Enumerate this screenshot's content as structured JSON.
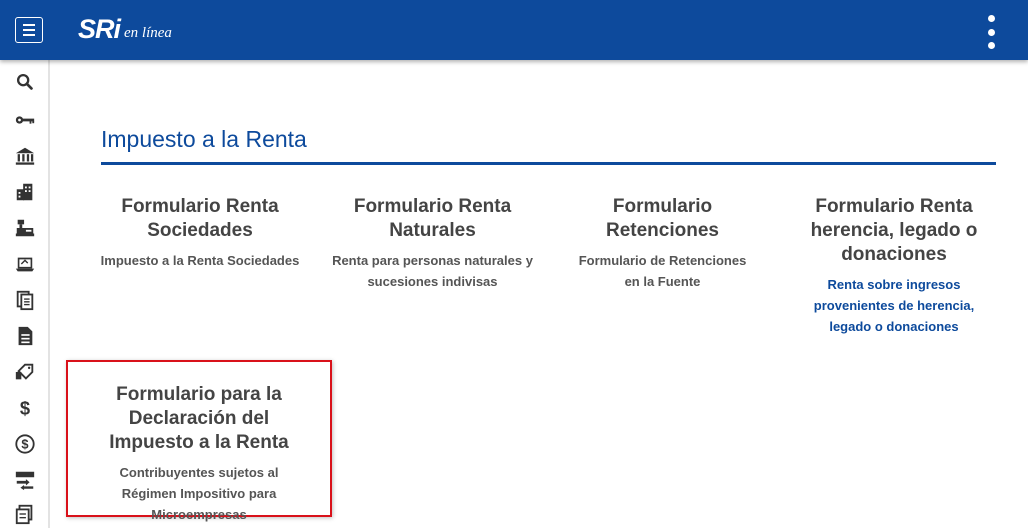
{
  "header": {
    "logo_main": "SRi",
    "logo_sub": "en línea"
  },
  "page": {
    "title": "Impuesto a la Renta"
  },
  "cards": [
    {
      "title": "Formulario Renta Sociedades",
      "desc": "Impuesto a la Renta Sociedades"
    },
    {
      "title": "Formulario Renta Naturales",
      "desc": "Renta para personas naturales y sucesiones indivisas"
    },
    {
      "title": "Formulario Retenciones",
      "desc": "Formulario de Retenciones en la Fuente"
    },
    {
      "title": "Formulario Renta herencia, legado o donaciones",
      "desc": "Renta sobre ingresos provenientes de herencia, legado o donaciones"
    },
    {
      "title": "Formulario para la Declaración del Impuesto a la Renta",
      "desc": "Contribuyentes sujetos al Régimen Impositivo para Microempresas"
    }
  ],
  "sidebar_icons": [
    "search-icon",
    "key-icon",
    "bank-icon",
    "buildings-icon",
    "cash-register-icon",
    "laptop-icon",
    "documents-icon",
    "document-icon",
    "tag-hand-icon",
    "dollar-icon",
    "dollar-circle-icon",
    "exchange-icon",
    "forms-icon"
  ],
  "colors": {
    "primary": "#0d4a9c",
    "highlight_border": "#d9111a"
  }
}
